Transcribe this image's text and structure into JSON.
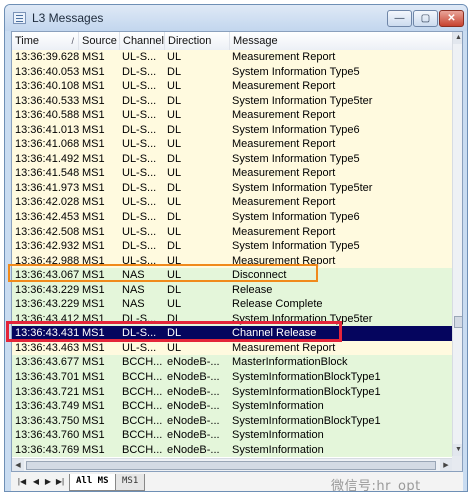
{
  "window": {
    "title": "L3 Messages",
    "minimize": "—",
    "maximize": "▢",
    "close": "✕"
  },
  "columns": [
    {
      "label": "Time",
      "sort_indicator": "/"
    },
    {
      "label": "Source"
    },
    {
      "label": "Channel"
    },
    {
      "label": "Direction"
    },
    {
      "label": "Message"
    }
  ],
  "rows": [
    {
      "time": "13:36:39.628",
      "source": "MS1",
      "channel": "UL-S...",
      "direction": "UL",
      "message": "Measurement Report",
      "bg": "y"
    },
    {
      "time": "13:36:40.053",
      "source": "MS1",
      "channel": "DL-S...",
      "direction": "DL",
      "message": "System Information Type5",
      "bg": "y"
    },
    {
      "time": "13:36:40.108",
      "source": "MS1",
      "channel": "UL-S...",
      "direction": "UL",
      "message": "Measurement Report",
      "bg": "y"
    },
    {
      "time": "13:36:40.533",
      "source": "MS1",
      "channel": "DL-S...",
      "direction": "DL",
      "message": "System Information Type5ter",
      "bg": "y"
    },
    {
      "time": "13:36:40.588",
      "source": "MS1",
      "channel": "UL-S...",
      "direction": "UL",
      "message": "Measurement Report",
      "bg": "y"
    },
    {
      "time": "13:36:41.013",
      "source": "MS1",
      "channel": "DL-S...",
      "direction": "DL",
      "message": "System Information Type6",
      "bg": "y"
    },
    {
      "time": "13:36:41.068",
      "source": "MS1",
      "channel": "UL-S...",
      "direction": "UL",
      "message": "Measurement Report",
      "bg": "y"
    },
    {
      "time": "13:36:41.492",
      "source": "MS1",
      "channel": "DL-S...",
      "direction": "DL",
      "message": "System Information Type5",
      "bg": "y"
    },
    {
      "time": "13:36:41.548",
      "source": "MS1",
      "channel": "UL-S...",
      "direction": "UL",
      "message": "Measurement Report",
      "bg": "y"
    },
    {
      "time": "13:36:41.973",
      "source": "MS1",
      "channel": "DL-S...",
      "direction": "DL",
      "message": "System Information Type5ter",
      "bg": "y"
    },
    {
      "time": "13:36:42.028",
      "source": "MS1",
      "channel": "UL-S...",
      "direction": "UL",
      "message": "Measurement Report",
      "bg": "y"
    },
    {
      "time": "13:36:42.453",
      "source": "MS1",
      "channel": "DL-S...",
      "direction": "DL",
      "message": "System Information Type6",
      "bg": "y"
    },
    {
      "time": "13:36:42.508",
      "source": "MS1",
      "channel": "UL-S...",
      "direction": "UL",
      "message": "Measurement Report",
      "bg": "y"
    },
    {
      "time": "13:36:42.932",
      "source": "MS1",
      "channel": "DL-S...",
      "direction": "DL",
      "message": "System Information Type5",
      "bg": "y"
    },
    {
      "time": "13:36:42.988",
      "source": "MS1",
      "channel": "UL-S...",
      "direction": "UL",
      "message": "Measurement Report",
      "bg": "y"
    },
    {
      "time": "13:36:43.067",
      "source": "MS1",
      "channel": "NAS",
      "direction": "UL",
      "message": "Disconnect",
      "bg": "g"
    },
    {
      "time": "13:36:43.229",
      "source": "MS1",
      "channel": "NAS",
      "direction": "DL",
      "message": "Release",
      "bg": "g"
    },
    {
      "time": "13:36:43.229",
      "source": "MS1",
      "channel": "NAS",
      "direction": "UL",
      "message": "Release Complete",
      "bg": "g"
    },
    {
      "time": "13:36:43.412",
      "source": "MS1",
      "channel": "DL-S...",
      "direction": "DL",
      "message": "System Information Type5ter",
      "bg": "g"
    },
    {
      "time": "13:36:43.431",
      "source": "MS1",
      "channel": "DL-S...",
      "direction": "DL",
      "message": "Channel Release",
      "bg": "sel"
    },
    {
      "time": "13:36:43.463",
      "source": "MS1",
      "channel": "UL-S...",
      "direction": "UL",
      "message": "Measurement Report",
      "bg": "y"
    },
    {
      "time": "13:36:43.677",
      "source": "MS1",
      "channel": "BCCH...",
      "direction": "eNodeB-...",
      "message": "MasterInformationBlock",
      "bg": "g"
    },
    {
      "time": "13:36:43.701",
      "source": "MS1",
      "channel": "BCCH...",
      "direction": "eNodeB-...",
      "message": "SystemInformationBlockType1",
      "bg": "g"
    },
    {
      "time": "13:36:43.721",
      "source": "MS1",
      "channel": "BCCH...",
      "direction": "eNodeB-...",
      "message": "SystemInformationBlockType1",
      "bg": "g"
    },
    {
      "time": "13:36:43.749",
      "source": "MS1",
      "channel": "BCCH...",
      "direction": "eNodeB-...",
      "message": "SystemInformation",
      "bg": "g"
    },
    {
      "time": "13:36:43.750",
      "source": "MS1",
      "channel": "BCCH...",
      "direction": "eNodeB-...",
      "message": "SystemInformationBlockType1",
      "bg": "g"
    },
    {
      "time": "13:36:43.760",
      "source": "MS1",
      "channel": "BCCH...",
      "direction": "eNodeB-...",
      "message": "SystemInformation",
      "bg": "g"
    },
    {
      "time": "13:36:43.769",
      "source": "MS1",
      "channel": "BCCH...",
      "direction": "eNodeB-...",
      "message": "SystemInformation",
      "bg": "g"
    }
  ],
  "tabs": {
    "first": "All MS",
    "second": "MS1"
  },
  "watermark": "微信号:hr_opt"
}
